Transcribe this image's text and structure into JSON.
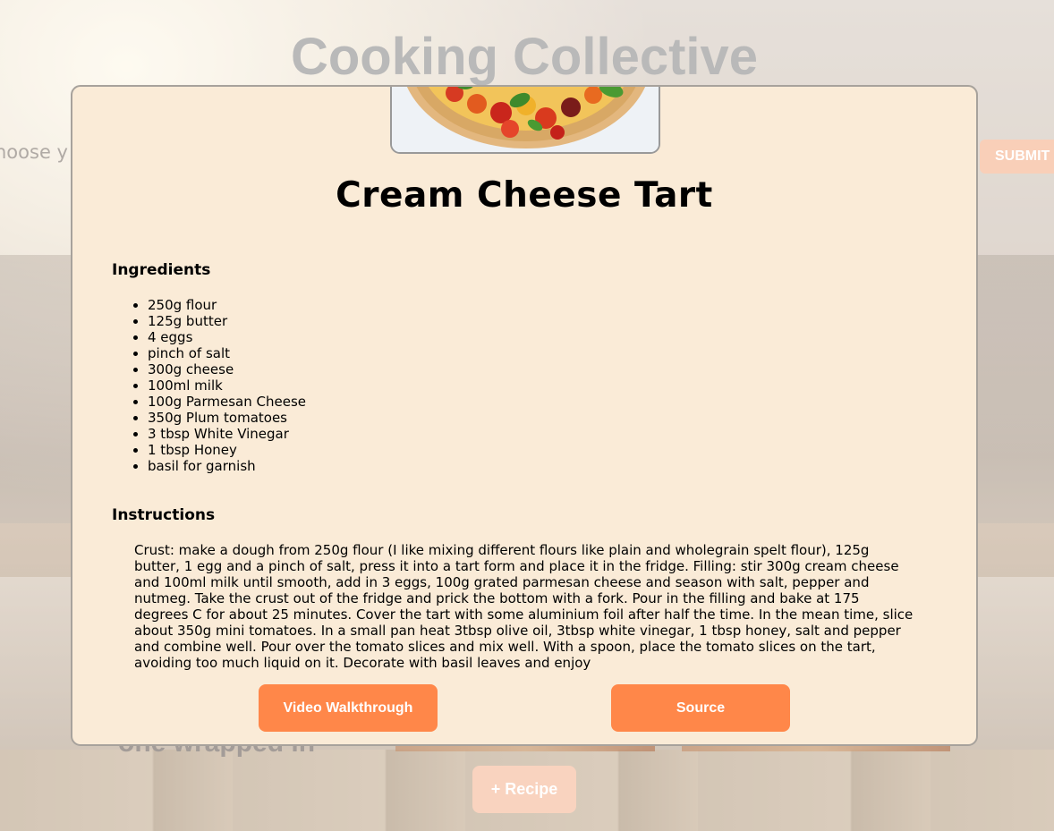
{
  "background": {
    "site_title": "Cooking Collective",
    "choose_prompt": "hoose y",
    "submit_label": "SUBMIT",
    "card_title": "one wrapped in",
    "add_recipe_label": "+ Recipe"
  },
  "modal": {
    "image_icon": "tomato-tart-photo",
    "title": "Cream Cheese Tart",
    "ingredients_heading": "Ingredients",
    "ingredients": [
      "250g flour",
      "125g butter",
      "4 eggs",
      "pinch of salt",
      "300g cheese",
      "100ml milk",
      "100g Parmesan Cheese",
      "350g Plum tomatoes",
      "3 tbsp White Vinegar",
      "1 tbsp Honey",
      "basil for garnish"
    ],
    "instructions_heading": "Instructions",
    "instructions": "Crust: make a dough from 250g flour (I like mixing different flours like plain and wholegrain spelt flour), 125g butter, 1 egg and a pinch of salt, press it into a tart form and place it in the fridge. Filling: stir 300g cream cheese and 100ml milk until smooth, add in 3 eggs, 100g grated parmesan cheese and season with salt, pepper and nutmeg. Take the crust out of the fridge and prick the bottom with a fork. Pour in the filling and bake at 175 degrees C for about 25 minutes. Cover the tart with some aluminium foil after half the time. In the mean time, slice about 350g mini tomatoes. In a small pan heat 3tbsp olive oil, 3tbsp white vinegar, 1 tbsp honey, salt and pepper and combine well. Pour over the tomato slices and mix well. With a spoon, place the tomato slices on the tart, avoiding too much liquid on it. Decorate with basil leaves and enjoy",
    "video_button_label": "Video Walkthrough",
    "source_button_label": "Source"
  },
  "colors": {
    "modal_background": "#faebd7",
    "accent_button": "#ff8749",
    "title_gray": "#b9b9b9"
  }
}
